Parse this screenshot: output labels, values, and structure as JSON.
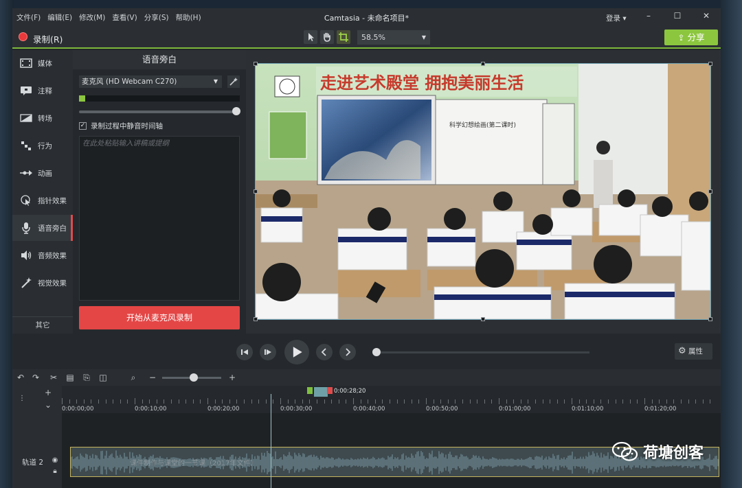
{
  "app": {
    "title": "Camtasia - 未命名项目*",
    "menu": [
      "文件(F)",
      "编辑(E)",
      "修改(M)",
      "查看(V)",
      "分享(S)",
      "帮助(H)"
    ],
    "login": "登录 ▾",
    "window_controls": [
      "–",
      "☐",
      "✕"
    ]
  },
  "toolbar": {
    "record_label": "录制(R)",
    "zoom": "58.5%",
    "share_label": "分享",
    "accent_color": "#8cc63f",
    "record_color": "#e8393b"
  },
  "sidebar": {
    "items": [
      {
        "label": "媒体",
        "icon": "film-icon"
      },
      {
        "label": "注释",
        "icon": "annotation-icon"
      },
      {
        "label": "转场",
        "icon": "transition-icon"
      },
      {
        "label": "行为",
        "icon": "behavior-icon"
      },
      {
        "label": "动画",
        "icon": "animation-icon"
      },
      {
        "label": "指针效果",
        "icon": "cursor-effect-icon"
      },
      {
        "label": "语音旁白",
        "icon": "microphone-icon",
        "active": true
      },
      {
        "label": "音频效果",
        "icon": "speaker-icon"
      },
      {
        "label": "视觉效果",
        "icon": "magic-wand-icon"
      }
    ],
    "other_label": "其它"
  },
  "voice_panel": {
    "title": "语音旁白",
    "mic_device": "麦克风 (HD Webcam C270)",
    "mute_checkbox_label": "录制过程中静音时间轴",
    "mute_checked": true,
    "script_placeholder": "在此处粘贴输入讲稿或提纲",
    "start_button_label": "开始从麦克风录制",
    "level": 0.04,
    "volume": 1.0
  },
  "canvas": {
    "banner_text": "走进艺术殿堂  拥抱美丽生活",
    "board_text": "科学幻想绘画(第二课时)"
  },
  "playback": {
    "properties_label": "属性",
    "position": 0.0
  },
  "timeline": {
    "playhead_time": "0:00:28;20",
    "ruler_labels": [
      "0:00:00;00",
      "0:00:10;00",
      "0:00:20;00",
      "0:00:30;00",
      "0:00:40;00",
      "0:00:50;00",
      "0:01:00;00",
      "0:01:10;00",
      "0:01:20;00"
    ],
    "track_name": "轨道 2",
    "clip_title": "课件制作与课堂的一节课（2017年文件）"
  },
  "watermark": {
    "text": "荷塘创客",
    "icon": "wechat-icon"
  }
}
